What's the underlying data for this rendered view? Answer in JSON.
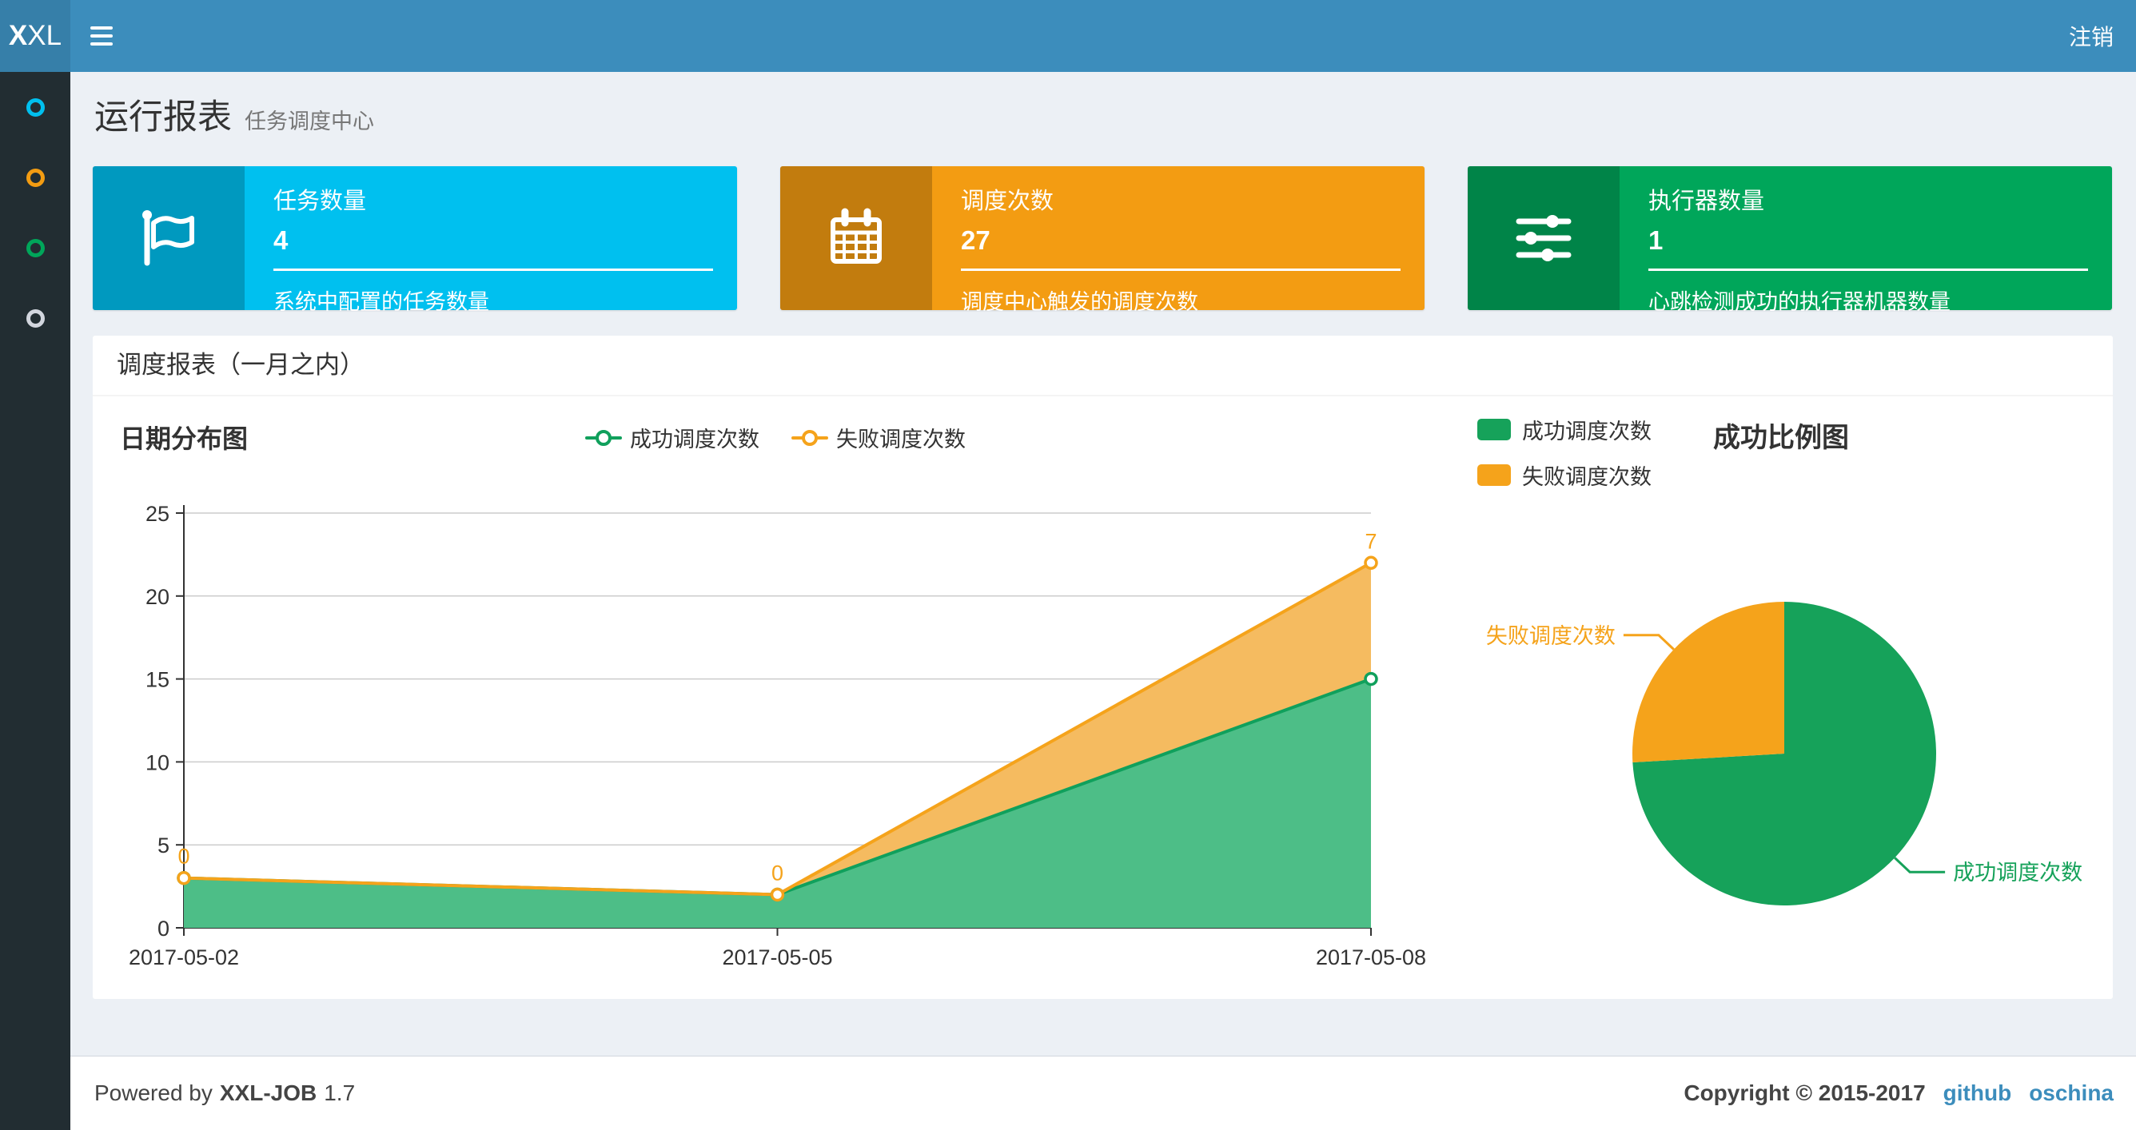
{
  "navbar": {
    "logo_bold": "X",
    "logo_rest": "XL",
    "logout_label": "注销"
  },
  "colors": {
    "navbar_bg": "#3c8dbc",
    "logo_bg": "#367fa9",
    "sidebar_bg": "#222d32",
    "content_bg": "#ecf0f5",
    "link": "#3c8dbc",
    "axis_text": "#333333",
    "gridline": "#cccccc"
  },
  "sidebar": {
    "items": [
      {
        "icon": "circle-o-icon",
        "color": "#00c0ef"
      },
      {
        "icon": "circle-o-icon",
        "color": "#f39c12"
      },
      {
        "icon": "circle-o-icon",
        "color": "#00a65a"
      },
      {
        "icon": "circle-o-icon",
        "color": "#d2d6de"
      }
    ]
  },
  "page_header": {
    "title": "运行报表",
    "subtitle": "任务调度中心"
  },
  "info_boxes": [
    {
      "icon": "flag-icon",
      "label": "任务数量",
      "value": "4",
      "description": "系统中配置的任务数量",
      "color": "#00c0ef"
    },
    {
      "icon": "calendar-icon",
      "label": "调度次数",
      "value": "27",
      "description": "调度中心触发的调度次数",
      "color": "#f39c12"
    },
    {
      "icon": "sliders-icon",
      "label": "执行器数量",
      "value": "1",
      "description": "心跳检测成功的执行器机器数量",
      "color": "#00a65a"
    }
  ],
  "panel": {
    "title": "调度报表（一月之内）"
  },
  "chart_data": [
    {
      "type": "area",
      "title": "日期分布图",
      "stacked": true,
      "grid": true,
      "legend_position": "top-center",
      "categories": [
        "2017-05-02",
        "2017-05-05",
        "2017-05-08"
      ],
      "series": [
        {
          "name": "成功调度次数",
          "values": [
            3,
            2,
            15
          ],
          "color": "#10a05c",
          "fill": "#4dbe87"
        },
        {
          "name": "失败调度次数",
          "values": [
            0,
            0,
            7
          ],
          "color": "#f5a31b",
          "fill": "#f5bb60",
          "point_labels": [
            "0",
            "0",
            "7"
          ]
        }
      ],
      "xlabel": "",
      "ylabel": "",
      "ylim": [
        0,
        25
      ],
      "yticks": [
        0,
        5,
        10,
        15,
        20,
        25
      ]
    },
    {
      "type": "pie",
      "title": "成功比例图",
      "legend_position": "top-left",
      "start_angle": 90,
      "slices": [
        {
          "name": "成功调度次数",
          "value": 20,
          "color": "#16a25a"
        },
        {
          "name": "失败调度次数",
          "value": 7,
          "color": "#f5a31b"
        }
      ]
    }
  ],
  "footer": {
    "powered_prefix": "Powered by",
    "product": "XXL-JOB",
    "version": "1.7",
    "copyright": "Copyright © 2015-2017",
    "links": [
      {
        "label": "github"
      },
      {
        "label": "oschina"
      }
    ]
  }
}
